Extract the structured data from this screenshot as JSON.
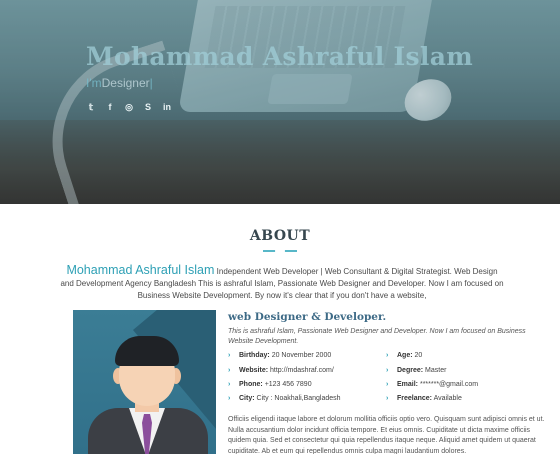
{
  "hero": {
    "name": "Mohammad Ashraful Islam",
    "subtitle_prefix": "I'm",
    "subtitle_role": "Designer",
    "subtitle_cursor": "|",
    "socials": [
      {
        "icon": "twitter-icon",
        "glyph": "𝕥"
      },
      {
        "icon": "facebook-icon",
        "glyph": "f"
      },
      {
        "icon": "instagram-icon",
        "glyph": "◎"
      },
      {
        "icon": "skype-icon",
        "glyph": "S"
      },
      {
        "icon": "linkedin-icon",
        "glyph": "in"
      }
    ]
  },
  "about": {
    "title": "ABOUT",
    "intro_name": "Mohammad Ashraful Islam",
    "intro_text": "Independent Web Developer | Web Consultant & Digital Strategist. Web Design and Development Agency Bangladesh This is ashraful Islam, Passionate Web Designer and Developer. Now I am focused on Business Website Development. By now it's clear that if you don't have a website,",
    "role": "web Designer & Developer.",
    "tagline": "This is ashraful Islam, Passionate Web Designer and Developer. Now I am focused on Business Website Development.",
    "facts_left": [
      {
        "label": "Birthday:",
        "value": "20 November 2000"
      },
      {
        "label": "Website:",
        "value": "http://mdashraf.com/"
      },
      {
        "label": "Phone:",
        "value": "+123 456 7890"
      },
      {
        "label": "City:",
        "value": "City : Noakhali,Bangladesh"
      }
    ],
    "facts_right": [
      {
        "label": "Age:",
        "value": "20"
      },
      {
        "label": "Degree:",
        "value": "Master"
      },
      {
        "label": "Email:",
        "value": "*******@gmail.com"
      },
      {
        "label": "Freelance:",
        "value": "Available"
      }
    ],
    "description": "Officiis eligendi itaque labore et dolorum mollitia officiis optio vero. Quisquam sunt adipisci omnis et ut. Nulla accusantium dolor incidunt officia tempore. Et eius omnis. Cupiditate ut dicta maxime officiis quidem quia. Sed et consectetur qui quia repellendus itaque neque. Aliquid amet quidem ut quaerat cupiditate. Ab et eum qui repellendus omnis culpa magni laudantium dolores."
  },
  "colors": {
    "accent": "#2ea0b5",
    "heading": "#37474f",
    "role": "#3d6a86"
  }
}
